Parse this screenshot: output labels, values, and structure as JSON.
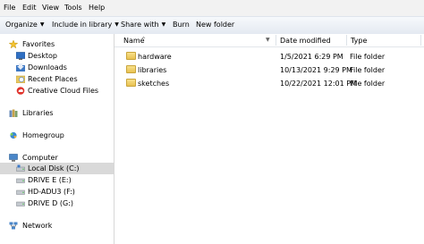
{
  "menu": {
    "items": [
      "File",
      "Edit",
      "View",
      "Tools",
      "Help"
    ]
  },
  "toolbar": {
    "organize": "Organize",
    "include_in_library": "Include in library",
    "share_with": "Share with",
    "burn": "Burn",
    "new_folder": "New folder"
  },
  "nav": {
    "favorites": "Favorites",
    "desktop": "Desktop",
    "downloads": "Downloads",
    "recent_places": "Recent Places",
    "creative_cloud": "Creative Cloud Files",
    "libraries": "Libraries",
    "homegroup": "Homegroup",
    "computer": "Computer",
    "local_disk": "Local Disk (C:)",
    "drive_e": "DRIVE E (E:)",
    "hd_adu3": "HD-ADU3 (F:)",
    "drive_d": "DRIVE D (G:)",
    "network": "Network"
  },
  "columns": {
    "name": "Name",
    "date_modified": "Date modified",
    "type": "Type",
    "sort_indicator": "^"
  },
  "files": [
    {
      "name": "hardware",
      "date": "1/5/2021 6:29 PM",
      "type": "File folder"
    },
    {
      "name": "libraries",
      "date": "10/13/2021 9:29 PM",
      "type": "File folder"
    },
    {
      "name": "sketches",
      "date": "10/22/2021 12:01 PM",
      "type": "File folder"
    }
  ],
  "colors": {
    "selected_nav": "#d9d9d9",
    "folder": "#e8c252",
    "toolbar": "#e4e9f1"
  }
}
